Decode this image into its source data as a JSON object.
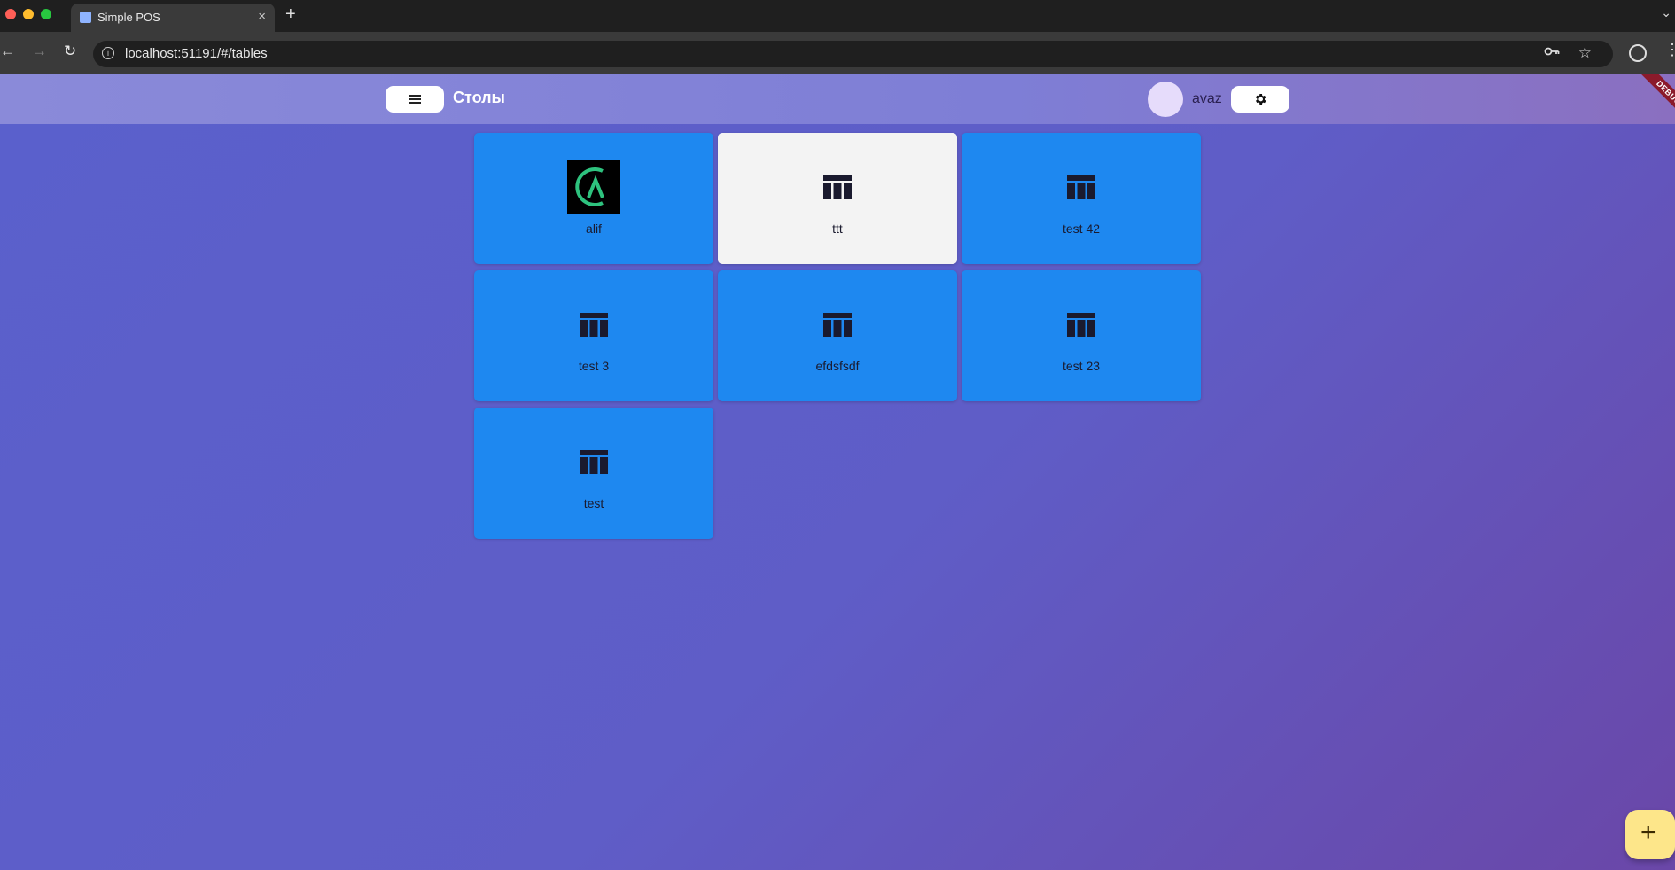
{
  "browser": {
    "tab_title": "Simple POS",
    "tab_close": "×",
    "new_tab": "+",
    "url": "localhost:51191/#/tables",
    "back": "←",
    "forward": "→",
    "reload": "↻",
    "bookmark": "☆",
    "kebab": "⋮",
    "tab_menu": "⌄"
  },
  "app": {
    "title": "Столы",
    "user": {
      "name": "avaz"
    },
    "debug_label": "DEBUG",
    "fab_label": "+"
  },
  "tables": [
    {
      "name": "alif",
      "icon": "alif-logo-icon",
      "selected": false
    },
    {
      "name": "ttt",
      "icon": "table-icon",
      "selected": true
    },
    {
      "name": "test 42",
      "icon": "table-icon",
      "selected": false
    },
    {
      "name": "test 3",
      "icon": "table-icon",
      "selected": false
    },
    {
      "name": "efdsfsdf",
      "icon": "table-icon",
      "selected": false
    },
    {
      "name": "test 23",
      "icon": "table-icon",
      "selected": false
    },
    {
      "name": "test",
      "icon": "table-icon",
      "selected": false
    }
  ],
  "colors": {
    "card": "#1e88f0",
    "card_selected": "#f3f3f3",
    "fab": "#fde68a",
    "alif_green": "#2ec27e"
  }
}
